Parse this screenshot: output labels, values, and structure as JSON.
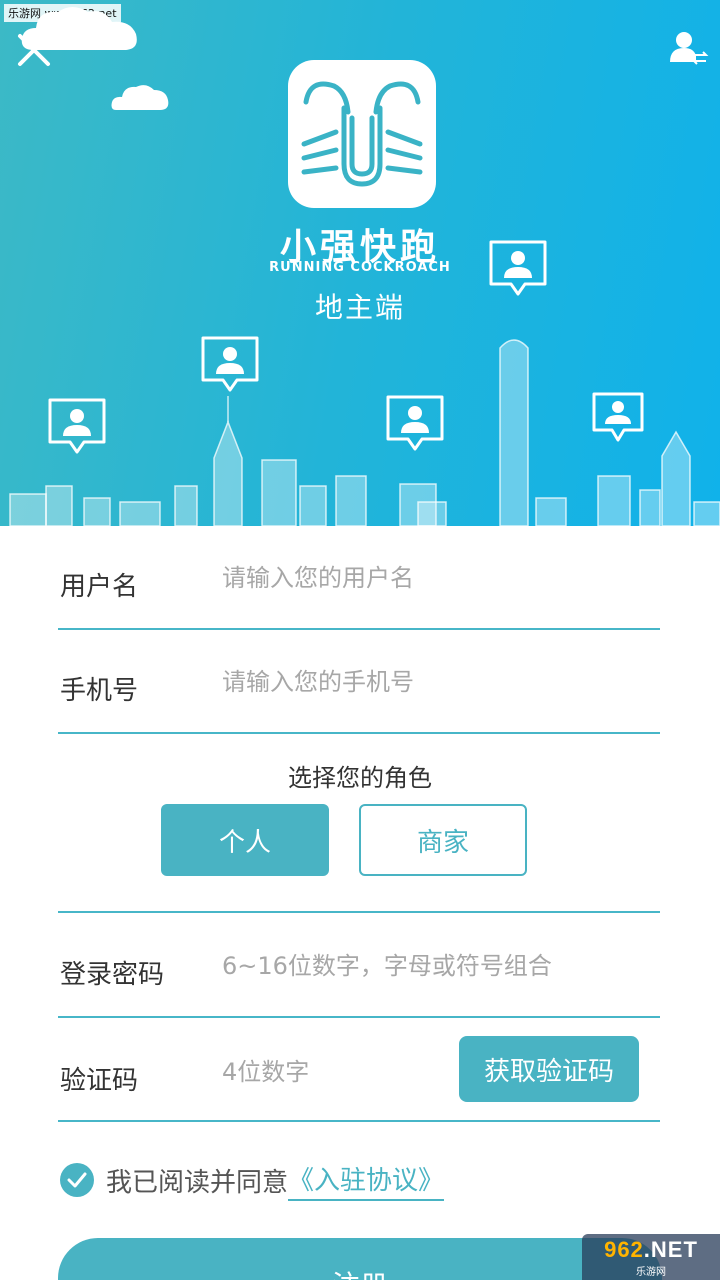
{
  "watermark_top": "乐游网 www.962.net",
  "header": {
    "app_name": "小强快跑",
    "app_name_en": "RUNNING COCKROACH",
    "app_role": "地主端"
  },
  "icons": {
    "close": "close-icon",
    "switch_account": "switch-account-icon",
    "logo": "cockroach-logo-icon",
    "pin": "user-location-pin-icon",
    "check": "check-icon"
  },
  "form": {
    "username": {
      "label": "用户名",
      "placeholder": "请输入您的用户名"
    },
    "phone": {
      "label": "手机号",
      "placeholder": "请输入您的手机号"
    },
    "role": {
      "title": "选择您的角色",
      "options": [
        {
          "label": "个人",
          "selected": true
        },
        {
          "label": "商家",
          "selected": false
        }
      ]
    },
    "password": {
      "label": "登录密码",
      "placeholder": "6~16位数字，字母或符号组合"
    },
    "code": {
      "label": "验证码",
      "placeholder": "4位数字",
      "button": "获取验证码"
    },
    "agreement": {
      "text": "我已阅读并同意",
      "link": "《入驻协议》",
      "checked": true
    },
    "submit": "注册"
  },
  "watermark_br": {
    "main": "962",
    "net": ".NET",
    "sub": "乐游网"
  },
  "colors": {
    "accent": "#49b3c3",
    "hero_start": "#3cb9c6",
    "hero_end": "#10b2ea"
  }
}
